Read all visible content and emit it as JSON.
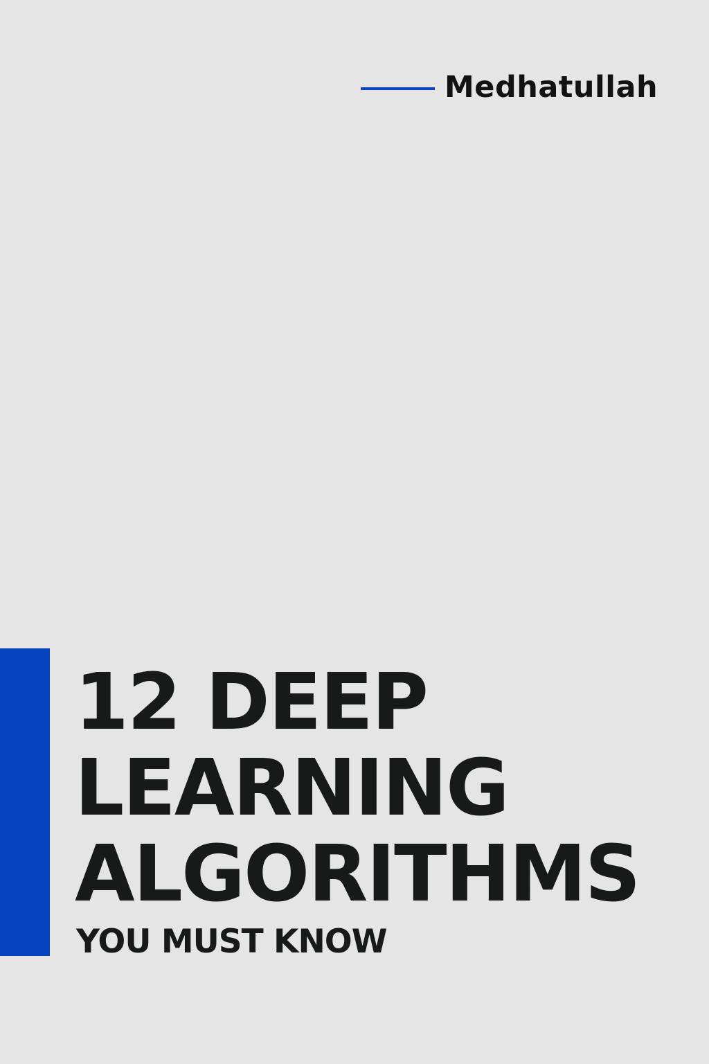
{
  "author": {
    "name": "Medhatullah",
    "accent_color": "#0b44c0"
  },
  "title": {
    "lines": [
      "12 DEEP",
      "LEARNING",
      "ALGORITHMS"
    ],
    "subtitle": "YOU MUST KNOW"
  },
  "colors": {
    "background": "#e5e5e5",
    "accent": "#0444c0",
    "text": "#181a1a"
  }
}
